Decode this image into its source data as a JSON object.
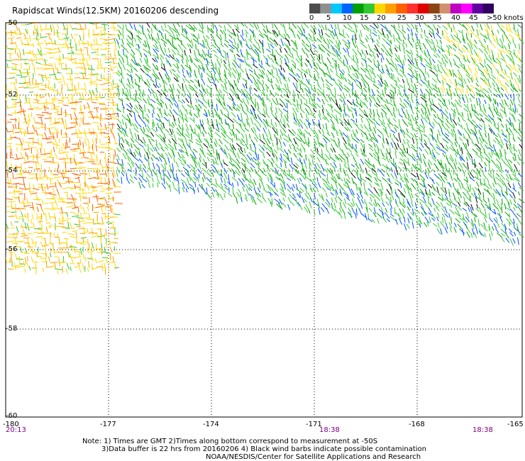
{
  "title": "Rapidscat Winds(12.5KM) 20160206 descending",
  "legend": {
    "colors": [
      "#4d4d4d",
      "#909090",
      "#00c8ff",
      "#0064ff",
      "#00a000",
      "#32c832",
      "#ffd700",
      "#ffa000",
      "#ff6000",
      "#ff3030",
      "#e00000",
      "#8b4513",
      "#d09070",
      "#c000c0",
      "#ff00ff",
      "#6000a0",
      "#300060"
    ],
    "ticks": [
      "0",
      "5",
      "10",
      "15",
      "20",
      "25",
      "30",
      "35",
      "40",
      "45"
    ],
    "units_label": ">50 knots"
  },
  "axes": {
    "lat_labels": [
      "-50",
      "-52",
      "-54",
      "-56",
      "-58",
      "-60"
    ],
    "lon_labels": [
      "-180",
      "-177",
      "-174",
      "-171",
      "-168",
      "-165"
    ],
    "time_labels": [
      "20:13",
      "18:38",
      "18:38"
    ]
  },
  "notes": [
    "Note: 1) Times are GMT 2)Times along bottom correspond to measurement at -50S",
    "3)Data buffer is 22 hrs from 20160206 4) Black wind barbs indicate possible contamination",
    "NOAA/NESDIS/Center for Satellite Applications and Research"
  ]
}
